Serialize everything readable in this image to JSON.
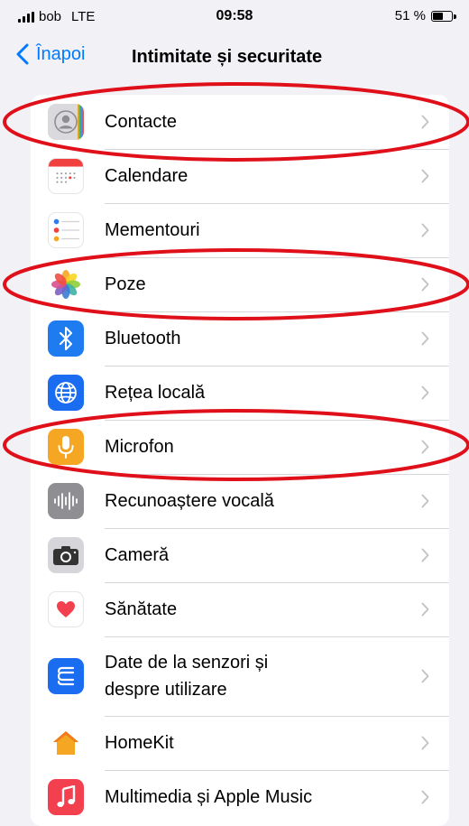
{
  "status": {
    "carrier": "bob",
    "network": "LTE",
    "time": "09:58",
    "battery": "51 %",
    "battery_level": 0.51
  },
  "nav": {
    "back_label": "Înapoi",
    "title": "Intimitate și securitate"
  },
  "items": [
    {
      "label": "Contacte",
      "icon": "contacts-icon"
    },
    {
      "label": "Calendare",
      "icon": "calendar-icon"
    },
    {
      "label": "Mementouri",
      "icon": "reminders-icon"
    },
    {
      "label": "Poze",
      "icon": "photos-icon"
    },
    {
      "label": "Bluetooth",
      "icon": "bluetooth-icon"
    },
    {
      "label": "Rețea locală",
      "icon": "globe-icon"
    },
    {
      "label": "Microfon",
      "icon": "microphone-icon"
    },
    {
      "label": "Recunoaștere vocală",
      "icon": "waveform-icon"
    },
    {
      "label": "Cameră",
      "icon": "camera-icon"
    },
    {
      "label": "Sănătate",
      "icon": "heart-icon"
    },
    {
      "label": "Date de la senzori și",
      "label2": "despre utilizare",
      "icon": "sensor-data-icon"
    },
    {
      "label": "HomeKit",
      "icon": "home-icon"
    },
    {
      "label": "Multimedia și Apple Music",
      "icon": "music-icon"
    }
  ],
  "colors": {
    "accent": "#007aff",
    "annotation": "#e0101a",
    "bluetooth": "#1f7cf0",
    "local_network": "#1a6cf0",
    "microphone": "#f5a623",
    "voice": "#8e8e93",
    "camera": "#333333",
    "sensor": "#1a6cf0",
    "music": "#f2404f"
  }
}
